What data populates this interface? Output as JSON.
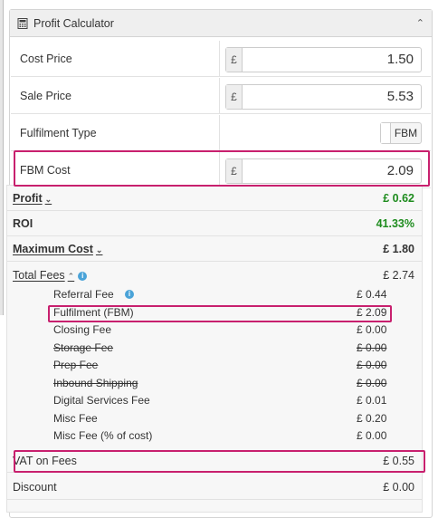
{
  "panel": {
    "title": "Profit Calculator",
    "collapse_icon": "chevron-up-icon",
    "icon": "calculator-icon"
  },
  "inputs": {
    "currency_symbol": "£",
    "cost_price": {
      "label": "Cost Price",
      "value": "1.50"
    },
    "sale_price": {
      "label": "Sale Price",
      "value": "5.53"
    },
    "fulfilment_type": {
      "label": "Fulfilment Type",
      "value": "FBM"
    },
    "fbm_cost": {
      "label": "FBM Cost",
      "value": "2.09"
    }
  },
  "results": {
    "profit": {
      "label": "Profit",
      "value": "£ 0.62"
    },
    "roi": {
      "label": "ROI",
      "value": "41.33%"
    },
    "max_cost": {
      "label": "Maximum Cost",
      "value": "£ 1.80"
    },
    "total_fees": {
      "label": "Total Fees",
      "value": "£ 2.74"
    },
    "fees": [
      {
        "label": "Referral Fee",
        "value": "£ 0.44",
        "info": true,
        "struck": false
      },
      {
        "label": "Fulfilment (FBM)",
        "value": "£ 2.09",
        "info": false,
        "struck": false
      },
      {
        "label": "Closing Fee",
        "value": "£ 0.00",
        "info": false,
        "struck": false
      },
      {
        "label": "Storage Fee",
        "value": "£ 0.00",
        "info": false,
        "struck": true
      },
      {
        "label": "Prep Fee",
        "value": "£ 0.00",
        "info": false,
        "struck": true
      },
      {
        "label": "Inbound Shipping",
        "value": "£ 0.00",
        "info": false,
        "struck": true
      },
      {
        "label": "Digital Services Fee",
        "value": "£ 0.01",
        "info": false,
        "struck": false
      },
      {
        "label": "Misc Fee",
        "value": "£ 0.20",
        "info": false,
        "struck": false
      },
      {
        "label": "Misc Fee (% of cost)",
        "value": "£ 0.00",
        "info": false,
        "struck": false
      }
    ],
    "vat_on_fees": {
      "label": "VAT on Fees",
      "value": "£ 0.55"
    },
    "discount": {
      "label": "Discount",
      "value": "£ 0.00"
    }
  },
  "colors": {
    "highlight": "#c8206e",
    "positive": "#1e8c1e",
    "info": "#4aa3d8"
  }
}
